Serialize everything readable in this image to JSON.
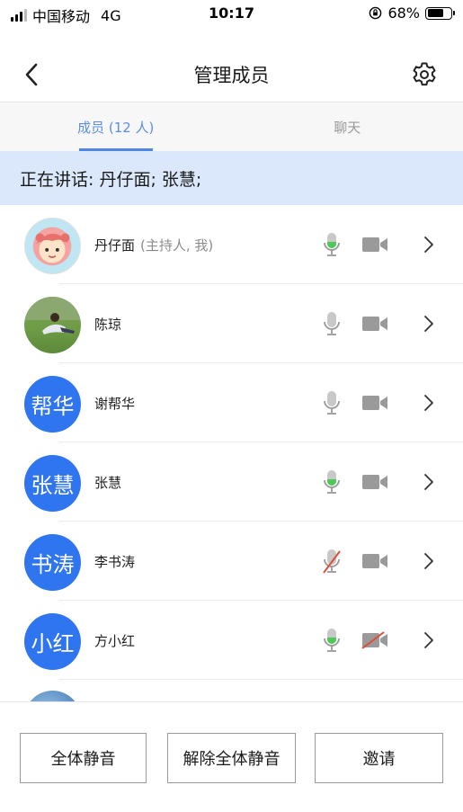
{
  "status": {
    "carrier": "中国移动",
    "network": "4G",
    "time": "10:17",
    "battery": "68%",
    "battery_level": 0.68
  },
  "nav": {
    "title": "管理成员",
    "back_icon": "chevron-left-icon",
    "settings_icon": "gear-icon"
  },
  "tabs": [
    {
      "label": "成员 (12 人)",
      "active": true
    },
    {
      "label": "聊天",
      "active": false
    }
  ],
  "speaking": {
    "text": "正在讲话: 丹仔面; 张慧;"
  },
  "members": [
    {
      "name": "丹仔面",
      "role": "(主持人, 我)",
      "avatar": "",
      "avatar_type": "image-cartoon",
      "mic": "active",
      "camera": "off"
    },
    {
      "name": "陈琼",
      "role": "",
      "avatar": "",
      "avatar_type": "image-photo",
      "mic": "off",
      "camera": "off"
    },
    {
      "name": "谢帮华",
      "role": "",
      "avatar": "帮华",
      "avatar_type": "text",
      "mic": "off",
      "camera": "off"
    },
    {
      "name": "张慧",
      "role": "",
      "avatar": "张慧",
      "avatar_type": "text",
      "mic": "active",
      "camera": "off"
    },
    {
      "name": "李书涛",
      "role": "",
      "avatar": "书涛",
      "avatar_type": "text",
      "mic": "muted",
      "camera": "off"
    },
    {
      "name": "方小红",
      "role": "",
      "avatar": "小红",
      "avatar_type": "text",
      "mic": "active",
      "camera": "disabled"
    }
  ],
  "actions": {
    "mute_all": "全体静音",
    "unmute_all": "解除全体静音",
    "invite": "邀请"
  },
  "colors": {
    "accent": "#4f86e6",
    "avatar_blue": "#2f75f0",
    "banner_bg": "#dbe8fb",
    "mic_active": "#4fc75a",
    "mute_red": "#e24a3b",
    "icon_grey": "#9a9a9a"
  }
}
